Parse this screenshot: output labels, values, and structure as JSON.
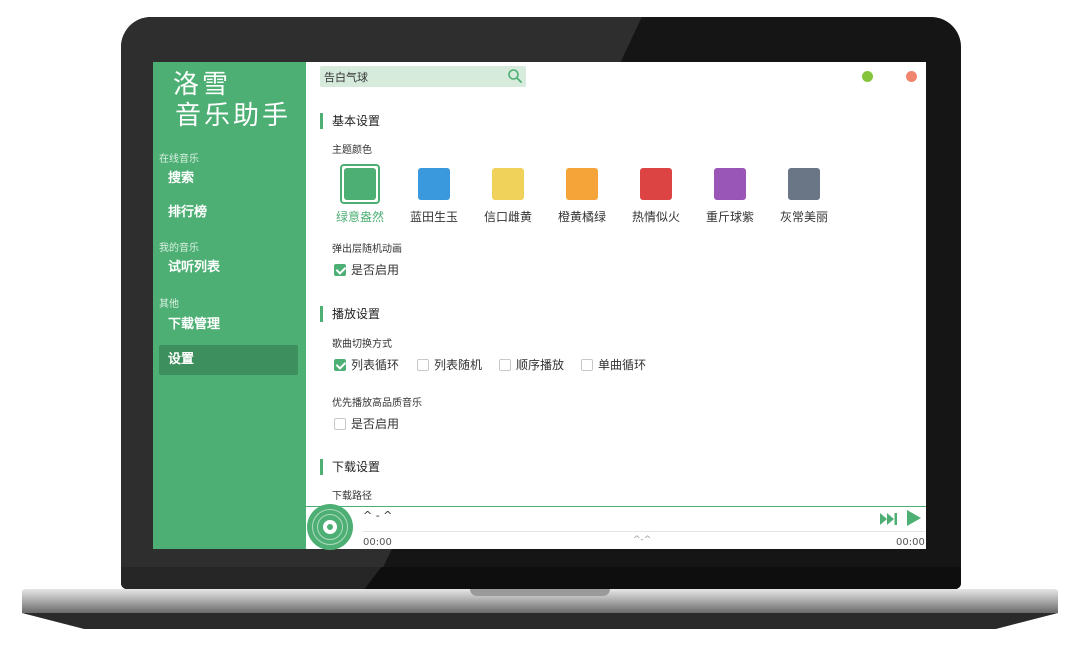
{
  "app": {
    "logo_line1": "洛雪",
    "logo_line2": "音乐助手"
  },
  "sidebar": {
    "groups": [
      {
        "label": "在线音乐",
        "items": [
          {
            "label": "搜索"
          },
          {
            "label": "排行榜"
          }
        ]
      },
      {
        "label": "我的音乐",
        "items": [
          {
            "label": "试听列表"
          }
        ]
      },
      {
        "label": "其他",
        "items": [
          {
            "label": "下载管理"
          },
          {
            "label": "设置",
            "active": true
          }
        ]
      }
    ]
  },
  "search": {
    "value": "告白气球"
  },
  "window_controls": {
    "minimize_color": "#85c43b",
    "close_color": "#f1846f"
  },
  "settings": {
    "basic": {
      "title": "基本设置",
      "theme_label": "主题颜色",
      "themes": [
        {
          "name": "绿意盎然",
          "color": "#4daf73",
          "selected": true
        },
        {
          "name": "蓝田生玉",
          "color": "#3a98dc"
        },
        {
          "name": "信口雌黄",
          "color": "#f0d15a"
        },
        {
          "name": "橙黄橘绿",
          "color": "#f5a43a"
        },
        {
          "name": "热情似火",
          "color": "#dc4343"
        },
        {
          "name": "重斤球紫",
          "color": "#9a56b7"
        },
        {
          "name": "灰常美丽",
          "color": "#6a7586"
        }
      ],
      "popup_label": "弹出层随机动画",
      "popup_option": {
        "label": "是否启用",
        "checked": true
      }
    },
    "playback": {
      "title": "播放设置",
      "switch_label": "歌曲切换方式",
      "modes": [
        {
          "label": "列表循环",
          "checked": true
        },
        {
          "label": "列表随机",
          "checked": false
        },
        {
          "label": "顺序播放",
          "checked": false
        },
        {
          "label": "单曲循环",
          "checked": false
        }
      ],
      "quality_label": "优先播放高品质音乐",
      "quality_option": {
        "label": "是否启用",
        "checked": false
      }
    },
    "download": {
      "title": "下载设置",
      "path_label": "下载路径"
    }
  },
  "player": {
    "title": "^ - ^",
    "progress_text": "^-^",
    "current_time": "00:00",
    "total_time": "00:00",
    "accent": "#4daf73"
  }
}
